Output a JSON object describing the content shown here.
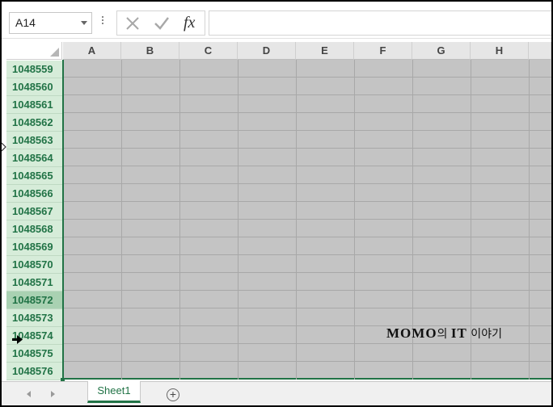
{
  "formula_bar": {
    "name_box_value": "A14",
    "cancel_icon": "x-icon",
    "enter_icon": "check-icon",
    "function_label": "fx",
    "formula_value": ""
  },
  "columns": [
    "A",
    "B",
    "C",
    "D",
    "E",
    "F",
    "G",
    "H"
  ],
  "rows": [
    "1048559",
    "1048560",
    "1048561",
    "1048562",
    "1048563",
    "1048564",
    "1048565",
    "1048566",
    "1048567",
    "1048568",
    "1048569",
    "1048570",
    "1048571",
    "1048572",
    "1048573",
    "1048574",
    "1048575",
    "1048576"
  ],
  "active_row": "1048572",
  "watermark": {
    "latin": "MOMO",
    "part2": "의 ",
    "latin2": "IT",
    "part3": " 이야기"
  },
  "sheet_tabs": {
    "tabs": [
      "Sheet1"
    ],
    "active": "Sheet1",
    "add_icon": "plus-circle-icon"
  },
  "colors": {
    "excel_green": "#217346",
    "selected_cells": "#c4c4c4",
    "row_header_selected": "#d6ecd9"
  }
}
